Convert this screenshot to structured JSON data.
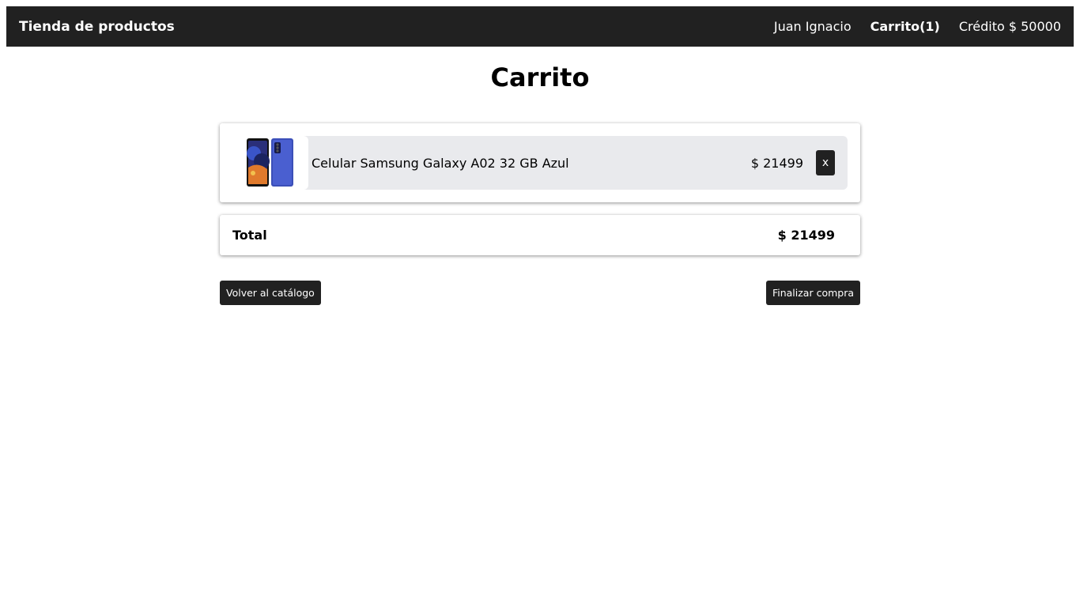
{
  "navbar": {
    "brand": "Tienda de productos",
    "user": "Juan Ignacio",
    "cart": "Carrito(1)",
    "credit": "Crédito $ 50000"
  },
  "page": {
    "title": "Carrito"
  },
  "cart": {
    "items": [
      {
        "name": "Celular Samsung Galaxy A02 32 GB Azul",
        "price": "$ 21499",
        "remove_label": "x",
        "image_icon": "phone-image"
      }
    ]
  },
  "summary": {
    "total_label": "Total",
    "total_value": "$ 21499"
  },
  "actions": {
    "back_label": "Volver al catálogo",
    "finish_label": "Finalizar compra"
  },
  "colors": {
    "navbar_bg": "#212121",
    "item_bg": "#e9eaed",
    "button_bg": "#212121"
  }
}
